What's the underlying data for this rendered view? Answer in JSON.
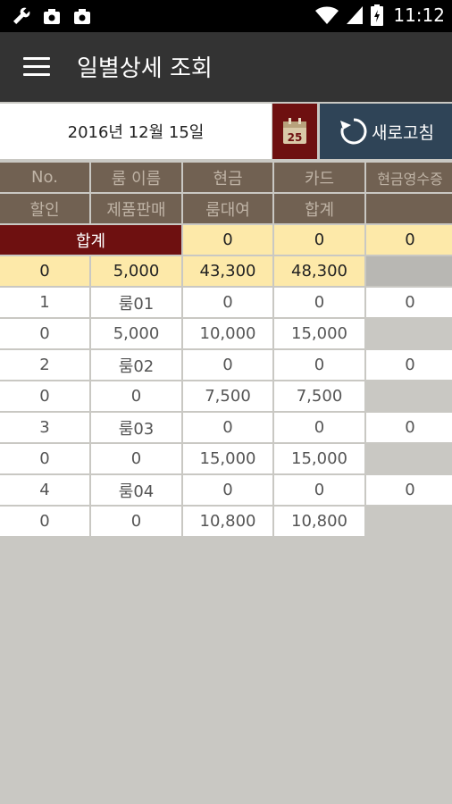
{
  "status_bar": {
    "time": "11:12",
    "icons": [
      "wrench-icon",
      "camera-icon",
      "camera-icon",
      "wifi-icon",
      "signal-icon",
      "battery-icon"
    ]
  },
  "app_bar": {
    "title": "일별상세 조회",
    "menu_icon": "hamburger-menu-icon"
  },
  "date_bar": {
    "date_value": "2016년 12월 15일",
    "calendar_day": "25",
    "refresh_label": "새로고침",
    "colors": {
      "calendar_bg": "#6e1010",
      "refresh_bg": "#2f4457"
    }
  },
  "table": {
    "header_row1": [
      "No.",
      "룸 이름",
      "현금",
      "카드",
      "현금영수증"
    ],
    "header_row2": [
      "할인",
      "제품판매",
      "룸대여",
      "합계",
      ""
    ],
    "summary_row1": [
      "합계",
      "0",
      "0",
      "0"
    ],
    "summary_row2": [
      "0",
      "5,000",
      "43,300",
      "48,300",
      ""
    ],
    "rooms": [
      {
        "line1": [
          "1",
          "룸01",
          "0",
          "0",
          "0"
        ],
        "line2": [
          "0",
          "5,000",
          "10,000",
          "15,000",
          ""
        ]
      },
      {
        "line1": [
          "2",
          "룸02",
          "0",
          "0",
          "0"
        ],
        "line2": [
          "0",
          "0",
          "7,500",
          "7,500",
          ""
        ]
      },
      {
        "line1": [
          "3",
          "룸03",
          "0",
          "0",
          "0"
        ],
        "line2": [
          "0",
          "0",
          "15,000",
          "15,000",
          ""
        ]
      },
      {
        "line1": [
          "4",
          "룸04",
          "0",
          "0",
          "0"
        ],
        "line2": [
          "0",
          "0",
          "10,800",
          "10,800",
          ""
        ]
      }
    ]
  }
}
